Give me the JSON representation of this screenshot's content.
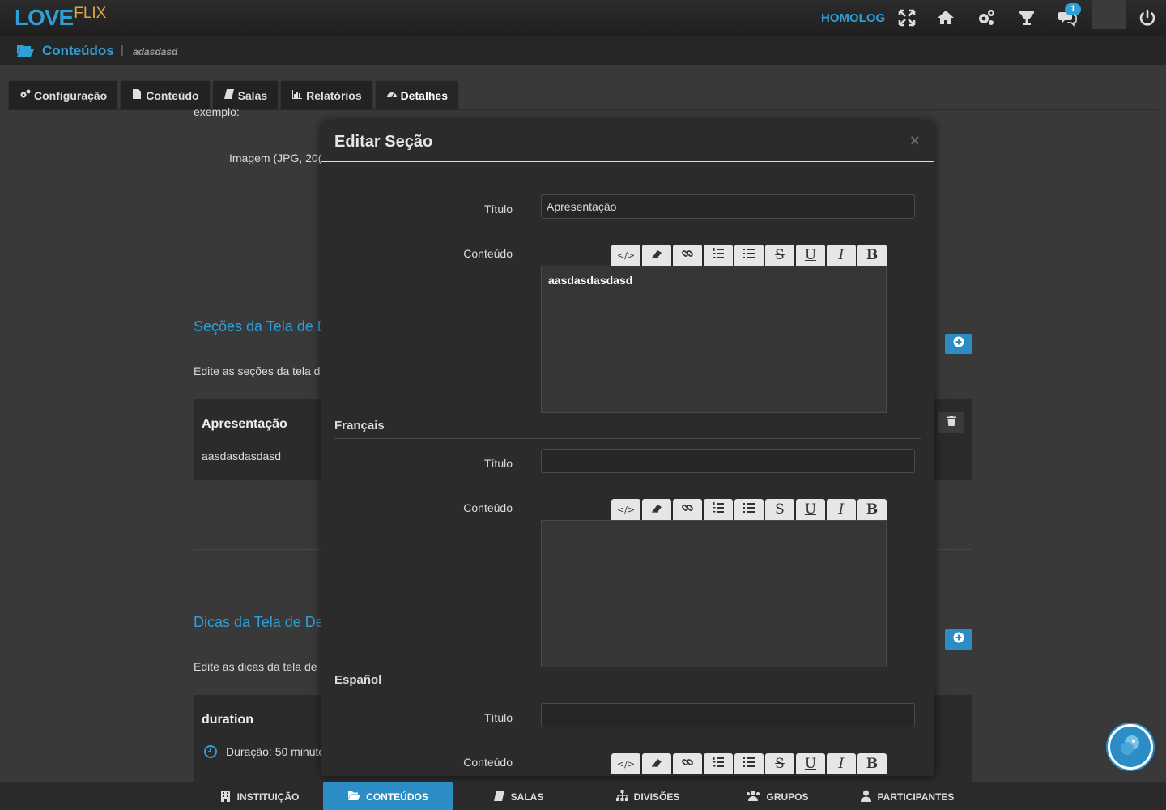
{
  "app": {
    "logo_main": "LOVE",
    "logo_sub": "FLIX",
    "environment": "HOMOLOG",
    "notification_count": "1",
    "accent_color": "#2f9fd8"
  },
  "breadcrumb": {
    "icon": "folder-open-icon",
    "title": "Conteúdos",
    "separator": "|",
    "subtitle": "adasdasd"
  },
  "tabs": [
    {
      "label": "Configuração",
      "icon": "cogs-icon"
    },
    {
      "label": "Conteúdo",
      "icon": "file-icon"
    },
    {
      "label": "Salas",
      "icon": "book-icon"
    },
    {
      "label": "Relatórios",
      "icon": "bar-chart-icon"
    },
    {
      "label": "Detalhes",
      "icon": "dashboard-icon"
    }
  ],
  "background": {
    "cut_text": "exemplo:",
    "image_hint": "Imagem (JPG, 20(",
    "sections_heading": "Seções da Tela de D",
    "sections_desc": "Edite as seções da tela d",
    "section_card": {
      "title": "Apresentação",
      "text": "aasdasdasdasd"
    },
    "tips_heading": "Dicas da Tela de De",
    "tips_desc": "Edite as dicas da tela de",
    "tip_card": {
      "title": "duration",
      "text": "Duração: 50 minuto"
    }
  },
  "modal": {
    "title": "Editar Seção",
    "close": "×",
    "title_label": "Título",
    "content_label": "Conteúdo",
    "default_block": {
      "title_value": "Apresentação",
      "content_value": "aasdasdasdasd"
    },
    "languages": [
      {
        "name": "Français",
        "title_value": "",
        "content_value": ""
      },
      {
        "name": "Español",
        "title_value": "",
        "content_value": ""
      }
    ],
    "toolbar": [
      {
        "name": "code-view-icon",
        "glyph": "</>"
      },
      {
        "name": "eraser-icon",
        "glyph": ""
      },
      {
        "name": "link-icon",
        "glyph": ""
      },
      {
        "name": "ordered-list-icon",
        "glyph": ""
      },
      {
        "name": "unordered-list-icon",
        "glyph": ""
      },
      {
        "name": "strikethrough-icon",
        "glyph": "S"
      },
      {
        "name": "underline-icon",
        "glyph": "U"
      },
      {
        "name": "italic-icon",
        "glyph": "I"
      },
      {
        "name": "bold-icon",
        "glyph": "B"
      }
    ]
  },
  "bottom_nav": [
    {
      "label": "INSTITUIÇÃO",
      "icon": "building-icon",
      "active": false
    },
    {
      "label": "CONTEÚDOS",
      "icon": "folder-open-icon",
      "active": true
    },
    {
      "label": "SALAS",
      "icon": "book-icon",
      "active": false
    },
    {
      "label": "DIVISÕES",
      "icon": "sitemap-icon",
      "active": false
    },
    {
      "label": "GRUPOS",
      "icon": "users-icon",
      "active": false
    },
    {
      "label": "PARTICIPANTES",
      "icon": "user-icon",
      "active": false
    }
  ]
}
